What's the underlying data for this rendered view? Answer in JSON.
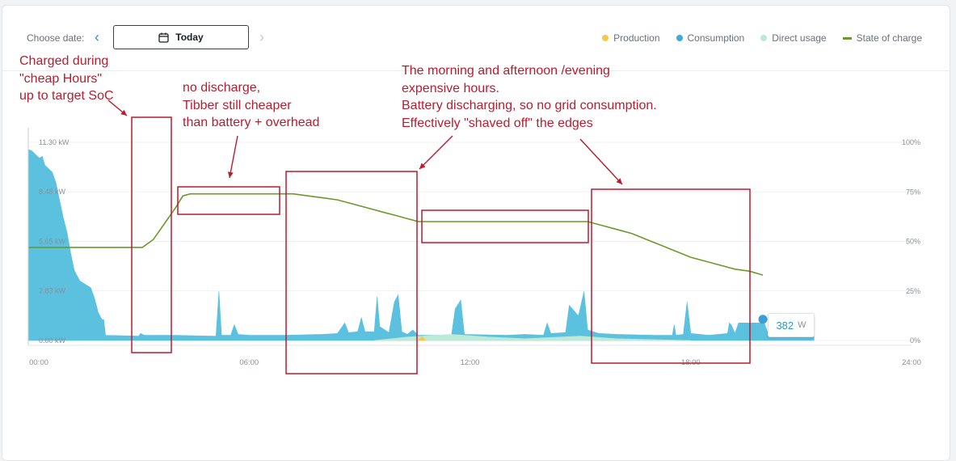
{
  "header": {
    "choose_date_label": "Choose date:",
    "date_button_label": "Today",
    "prev_icon": "chevron-left-icon",
    "next_icon": "chevron-right-icon",
    "calendar_icon": "calendar-icon"
  },
  "legend": [
    {
      "label": "Production",
      "color": "#f2c94c",
      "marker": "dot"
    },
    {
      "label": "Consumption",
      "color": "#3aaed8",
      "marker": "dot"
    },
    {
      "label": "Direct usage",
      "color": "#bde9d8",
      "marker": "dot"
    },
    {
      "label": "State of charge",
      "color": "#6b9a2a",
      "marker": "line"
    }
  ],
  "tooltip": {
    "value": "382",
    "unit": "W"
  },
  "annotations": {
    "a1": [
      "Charged during",
      "\"cheap Hours\"",
      "up to target SoC"
    ],
    "a2": [
      "no discharge,",
      "Tibber still cheaper",
      "than battery + overhead"
    ],
    "a3": [
      "The morning and afternoon /evening",
      "expensive hours.",
      "Battery discharging, so no grid consumption.",
      "Effectively \"shaved off\" the edges"
    ]
  },
  "chart_data": {
    "type": "area",
    "x_unit": "hours",
    "xlim": [
      0,
      24
    ],
    "ylim_left": [
      0,
      11.3
    ],
    "ylim_right": [
      0,
      100
    ],
    "x_tick_labels": [
      "00:00",
      "06:00",
      "12:00",
      "18:00",
      "24:00"
    ],
    "x_ticks": [
      0,
      6,
      12,
      18,
      24
    ],
    "y_left_tick_labels": [
      "0.00 kW",
      "2.83 kW",
      "5.65 kW",
      "8.48 kW",
      "11.30 kW"
    ],
    "y_left_ticks": [
      0,
      2.83,
      5.65,
      8.48,
      11.3
    ],
    "y_right_tick_labels": [
      "0%",
      "25%",
      "50%",
      "75%",
      "100%"
    ],
    "y_right_ticks": [
      0,
      25,
      50,
      75,
      100
    ],
    "series": [
      {
        "name": "Consumption",
        "unit": "kW",
        "color": "#5cc0df",
        "points": [
          [
            0.0,
            10.9
          ],
          [
            0.1,
            10.8
          ],
          [
            0.2,
            10.6
          ],
          [
            0.3,
            10.4
          ],
          [
            0.38,
            10.5
          ],
          [
            0.45,
            10.0
          ],
          [
            0.55,
            9.8
          ],
          [
            0.65,
            9.6
          ],
          [
            0.75,
            9.0
          ],
          [
            0.85,
            8.0
          ],
          [
            0.95,
            7.0
          ],
          [
            1.05,
            6.2
          ],
          [
            1.15,
            5.0
          ],
          [
            1.25,
            4.0
          ],
          [
            1.4,
            3.4
          ],
          [
            1.55,
            3.2
          ],
          [
            1.7,
            3.0
          ],
          [
            1.8,
            2.4
          ],
          [
            1.9,
            1.6
          ],
          [
            2.0,
            1.2
          ],
          [
            2.05,
            1.2
          ],
          [
            2.1,
            0.3
          ],
          [
            3.0,
            0.25
          ],
          [
            3.05,
            0.4
          ],
          [
            3.15,
            0.3
          ],
          [
            4.0,
            0.3
          ],
          [
            5.0,
            0.25
          ],
          [
            5.1,
            0.25
          ],
          [
            5.18,
            2.8
          ],
          [
            5.25,
            0.3
          ],
          [
            5.2,
            0.3
          ],
          [
            5.5,
            0.3
          ],
          [
            5.6,
            0.9
          ],
          [
            5.7,
            0.35
          ],
          [
            6.0,
            0.3
          ],
          [
            7.0,
            0.3
          ],
          [
            8.0,
            0.35
          ],
          [
            8.4,
            0.4
          ],
          [
            8.6,
            1.0
          ],
          [
            8.7,
            0.45
          ],
          [
            8.95,
            0.5
          ],
          [
            9.05,
            1.3
          ],
          [
            9.15,
            0.5
          ],
          [
            9.4,
            0.5
          ],
          [
            9.48,
            2.5
          ],
          [
            9.55,
            0.8
          ],
          [
            9.8,
            0.45
          ],
          [
            9.95,
            2.2
          ],
          [
            10.05,
            2.6
          ],
          [
            10.15,
            0.5
          ],
          [
            10.3,
            0.35
          ],
          [
            10.45,
            0.6
          ],
          [
            10.6,
            0.3
          ],
          [
            11.5,
            0.3
          ],
          [
            11.6,
            1.8
          ],
          [
            11.75,
            2.3
          ],
          [
            11.85,
            0.35
          ],
          [
            13.0,
            0.3
          ],
          [
            13.5,
            0.35
          ],
          [
            14.0,
            0.3
          ],
          [
            14.1,
            1.0
          ],
          [
            14.2,
            0.4
          ],
          [
            14.6,
            0.45
          ],
          [
            14.7,
            2.0
          ],
          [
            14.95,
            1.4
          ],
          [
            15.1,
            2.8
          ],
          [
            15.2,
            0.6
          ],
          [
            15.5,
            0.4
          ],
          [
            16.0,
            0.35
          ],
          [
            17.0,
            0.3
          ],
          [
            17.5,
            0.3
          ],
          [
            17.55,
            0.9
          ],
          [
            17.6,
            0.3
          ],
          [
            17.8,
            0.35
          ],
          [
            17.9,
            2.2
          ],
          [
            18.0,
            0.4
          ],
          [
            18.5,
            0.3
          ],
          [
            19.0,
            0.4
          ],
          [
            19.05,
            1.0
          ],
          [
            19.1,
            0.9
          ],
          [
            19.2,
            0.4
          ],
          [
            19.3,
            1.0
          ],
          [
            20.0,
            1.0
          ],
          [
            20.1,
            0.4
          ],
          [
            20.5,
            0.4
          ],
          [
            20.6,
            1.3
          ],
          [
            20.7,
            0.4
          ],
          [
            20.85,
            0.4
          ],
          [
            20.9,
            1.2
          ],
          [
            20.95,
            0.4
          ],
          [
            21.35,
            0.38
          ]
        ]
      },
      {
        "name": "Direct usage",
        "unit": "kW",
        "color": "#bde9d8",
        "points": [
          [
            9.4,
            0.0
          ],
          [
            10.3,
            0.2
          ],
          [
            11.5,
            0.35
          ],
          [
            12.5,
            0.2
          ],
          [
            13.5,
            0.1
          ],
          [
            15.0,
            0.25
          ],
          [
            16.0,
            0.1
          ],
          [
            17.0,
            0.05
          ],
          [
            18.0,
            0.0
          ]
        ]
      },
      {
        "name": "Production",
        "unit": "kW",
        "color": "#f2c94c",
        "points": [
          [
            10.6,
            0.0
          ],
          [
            10.7,
            0.22
          ],
          [
            10.8,
            0.0
          ]
        ]
      },
      {
        "name": "State of charge",
        "unit": "%",
        "color": "#6b9a2a",
        "points": [
          [
            0.0,
            47
          ],
          [
            3.1,
            47
          ],
          [
            3.4,
            51
          ],
          [
            3.7,
            59
          ],
          [
            4.0,
            67
          ],
          [
            4.2,
            73
          ],
          [
            4.4,
            74
          ],
          [
            7.2,
            74
          ],
          [
            7.6,
            73
          ],
          [
            8.0,
            72
          ],
          [
            8.4,
            71
          ],
          [
            8.8,
            69
          ],
          [
            9.2,
            67
          ],
          [
            9.6,
            65
          ],
          [
            10.0,
            63
          ],
          [
            10.6,
            60
          ],
          [
            15.2,
            60
          ],
          [
            15.6,
            58
          ],
          [
            16.0,
            56
          ],
          [
            16.4,
            54
          ],
          [
            16.8,
            51
          ],
          [
            17.2,
            48
          ],
          [
            17.6,
            45
          ],
          [
            18.0,
            42
          ],
          [
            18.4,
            40
          ],
          [
            18.8,
            38
          ],
          [
            19.2,
            36
          ],
          [
            19.6,
            35
          ],
          [
            19.96,
            33
          ]
        ]
      }
    ],
    "current_point": {
      "x": 19.96,
      "y": 0.382
    }
  }
}
